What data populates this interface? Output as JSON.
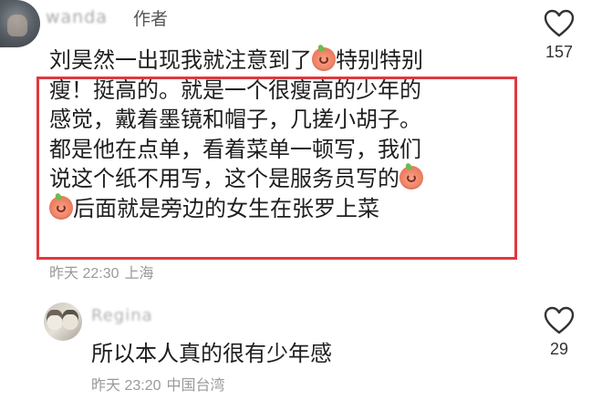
{
  "comment1": {
    "username": "wanda",
    "author_tag": "作者",
    "lines": [
      "刘昊然一出现我就注意到了",
      "特别特别",
      "瘦！挺高的。就是一个很瘦高的少年的",
      "感觉，戴着墨镜和帽子，几搓小胡子。",
      "都是他在点单，看着菜单一顿写，我们",
      "说这个纸不用写，这个是服务员写的",
      "后面就是旁边的女生在张罗上菜"
    ],
    "emoji_icon": "peach-face-emoji",
    "time": "昨天 22:30",
    "location": "上海",
    "like_count": "157",
    "highlight_color": "#e0383f"
  },
  "comment2": {
    "username": "Regina",
    "text": "所以本人真的很有少年感",
    "time": "昨天 23:20",
    "location": "中国台湾",
    "like_count": "29"
  }
}
